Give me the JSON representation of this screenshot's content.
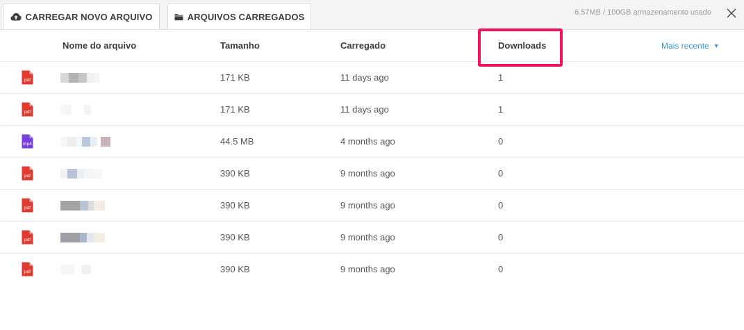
{
  "topbar": {
    "tabs": [
      {
        "label": "CARREGAR NOVO ARQUIVO",
        "icon": "cloud-upload-icon"
      },
      {
        "label": "ARQUIVOS CARREGADOS",
        "icon": "folder-icon"
      }
    ],
    "storage": "6.57MB / 100GB armazenamento usado",
    "close_icon": "close-icon"
  },
  "table": {
    "headers": {
      "name": "Nome do arquivo",
      "size": "Tamanho",
      "uploaded": "Carregado",
      "downloads": "Downloads"
    },
    "sort_label": "Mais recente",
    "sort_icon": "caret-down-icon",
    "rows": [
      {
        "type": "pdf",
        "size": "171 KB",
        "uploaded": "11 days ago",
        "downloads": "1"
      },
      {
        "type": "pdf",
        "size": "171 KB",
        "uploaded": "11 days ago",
        "downloads": "1"
      },
      {
        "type": "mp4",
        "size": "44.5 MB",
        "uploaded": "4 months ago",
        "downloads": "0"
      },
      {
        "type": "pdf",
        "size": "390 KB",
        "uploaded": "9 months ago",
        "downloads": "0"
      },
      {
        "type": "pdf",
        "size": "390 KB",
        "uploaded": "9 months ago",
        "downloads": "0"
      },
      {
        "type": "pdf",
        "size": "390 KB",
        "uploaded": "9 months ago",
        "downloads": "0"
      },
      {
        "type": "pdf",
        "size": "390 KB",
        "uploaded": "9 months ago",
        "downloads": "0"
      }
    ]
  },
  "colors": {
    "accent": "#3a9ad9",
    "highlight": "#f0145a",
    "pdf": "#e03b30",
    "mp4": "#7a3fe0"
  }
}
